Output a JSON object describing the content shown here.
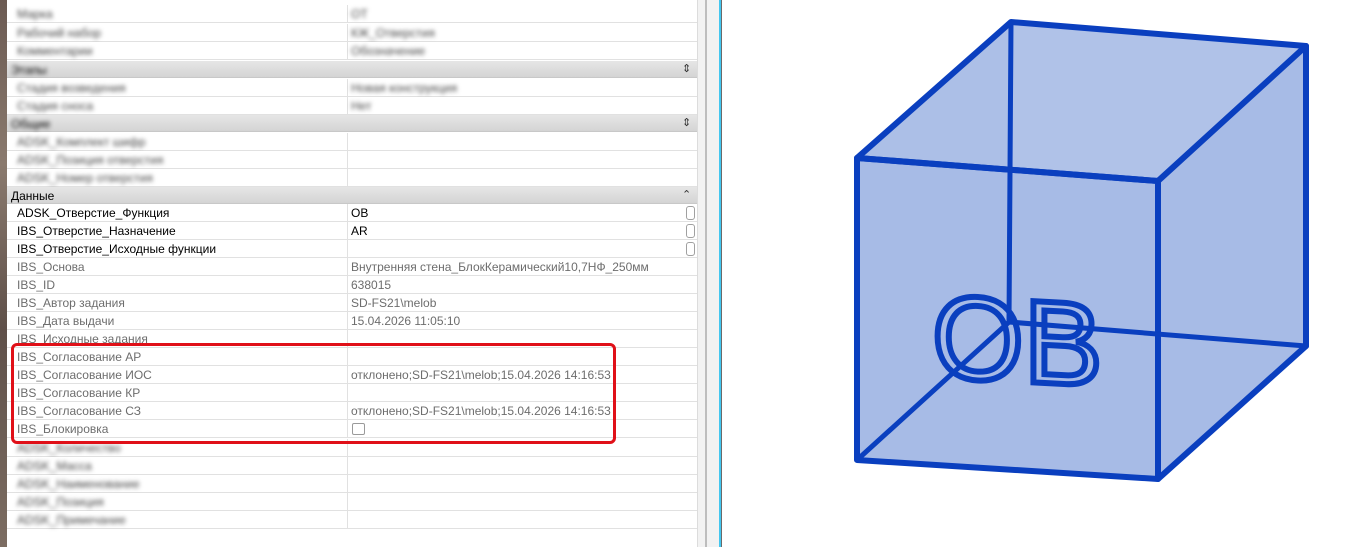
{
  "properties": {
    "blurred_top_rows": [
      {
        "name": "Марка",
        "value": "ОТ"
      },
      {
        "name": "Рабочий набор",
        "value": "КЖ_Отверстия"
      },
      {
        "name": "Комментарии",
        "value": "Обозначение"
      }
    ],
    "groups": {
      "g1": {
        "title": "Этапы",
        "toggle": "⇕"
      },
      "g1_rows": [
        {
          "name": "Стадия возведения",
          "value": "Новая конструкция"
        },
        {
          "name": "Стадия сноса",
          "value": "Нет"
        }
      ],
      "g2": {
        "title": "Общие",
        "toggle": "⇕"
      },
      "g2_rows": [
        {
          "name": "ADSK_Комплект шифр",
          "value": ""
        },
        {
          "name": "ADSK_Позиция отверстия",
          "value": ""
        },
        {
          "name": "ADSK_Номер отверстия",
          "value": ""
        }
      ],
      "data": {
        "title": "Данные",
        "toggle": "⌃"
      }
    },
    "data_rows": [
      {
        "name": "ADSK_Отверстие_Функция",
        "value": "OB"
      },
      {
        "name": "IBS_Отверстие_Назначение",
        "value": "AR"
      },
      {
        "name": "IBS_Отверстие_Исходные функции",
        "value": ""
      },
      {
        "name": "IBS_Основа",
        "value": "Внутренняя стена_БлокКерамический10,7НФ_250мм"
      },
      {
        "name": "IBS_ID",
        "value": "638015"
      },
      {
        "name": "IBS_Автор задания",
        "value": "SD-FS21\\melob"
      },
      {
        "name": "IBS_Дата выдачи",
        "value": "15.04.2026 11:05:10"
      },
      {
        "name": "IBS_Исходные задания",
        "value": ""
      },
      {
        "name": "IBS_Согласование АР",
        "value": ""
      },
      {
        "name": "IBS_Согласование ИОС",
        "value": "отклонено;SD-FS21\\melob;15.04.2026 14:16:53"
      },
      {
        "name": "IBS_Согласование КР",
        "value": ""
      },
      {
        "name": "IBS_Согласование СЗ",
        "value": "отклонено;SD-FS21\\melob;15.04.2026 14:16:53"
      },
      {
        "name": "IBS_Блокировка",
        "value": ""
      }
    ],
    "blurred_bottom_rows": [
      {
        "name": "ADSK_Количество",
        "value": ""
      },
      {
        "name": "ADSK_Масса",
        "value": ""
      },
      {
        "name": "ADSK_Наименование",
        "value": ""
      },
      {
        "name": "ADSK_Позиция",
        "value": ""
      },
      {
        "name": "ADSK_Примечание",
        "value": ""
      }
    ]
  },
  "viewport": {
    "label": "OB",
    "colors": {
      "edge": "#0a3fbf",
      "face": "#a7bbe6"
    }
  }
}
